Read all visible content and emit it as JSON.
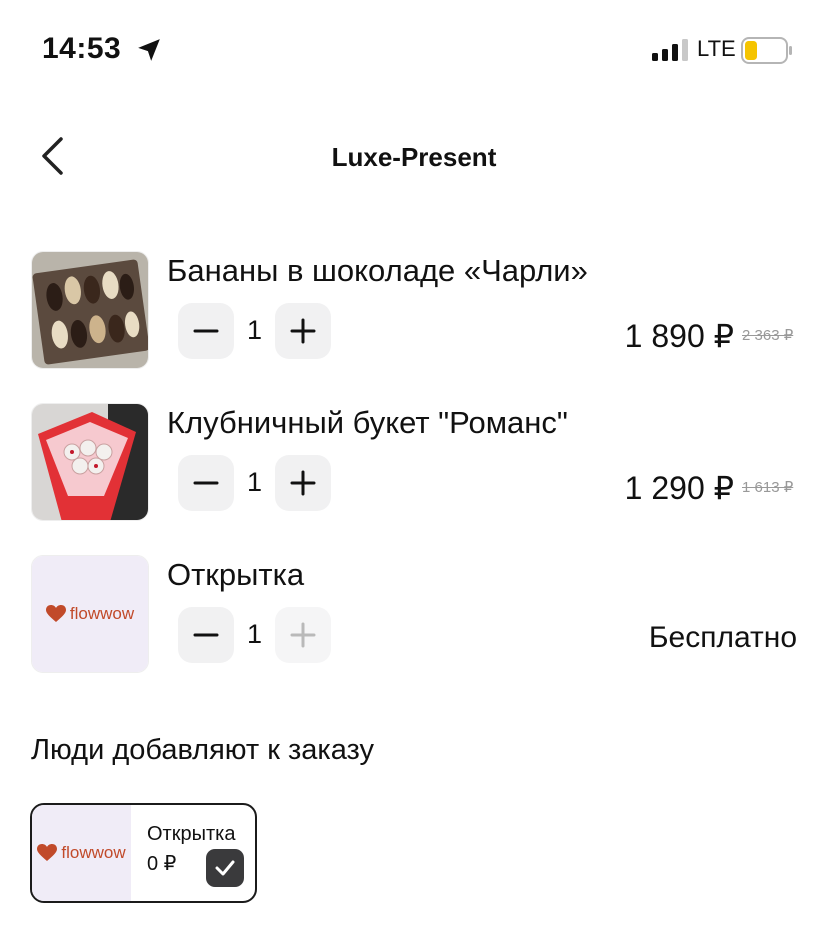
{
  "status_bar": {
    "time": "14:53",
    "network": "LTE",
    "icons": [
      "location-arrow-icon",
      "signal-icon",
      "battery-icon"
    ]
  },
  "header": {
    "title": "Luxe-Present",
    "back_icon": "chevron-left-icon"
  },
  "cart": {
    "items": [
      {
        "name": "Бананы в шоколаде «Чарли»",
        "quantity": "1",
        "price": "1 890 ₽",
        "old_price": "2 363 ₽"
      },
      {
        "name": "Клубничный букет \"Романс\"",
        "quantity": "1",
        "price": "1 290 ₽",
        "old_price": "1 613 ₽"
      },
      {
        "name": "Открытка",
        "quantity": "1",
        "price": "Бесплатно",
        "logo_text": "flowwow",
        "plus_disabled": true
      }
    ]
  },
  "upsell": {
    "title": "Люди добавляют к заказу",
    "items": [
      {
        "name": "Открытка",
        "price": "0 ₽",
        "logo_text": "flowwow",
        "checked": true
      }
    ]
  },
  "colors": {
    "brand_logo": "#c14a2a",
    "card_bg": "#f0ecf7",
    "battery_fill": "#f5c400",
    "button_bg": "#f1f1f2"
  }
}
